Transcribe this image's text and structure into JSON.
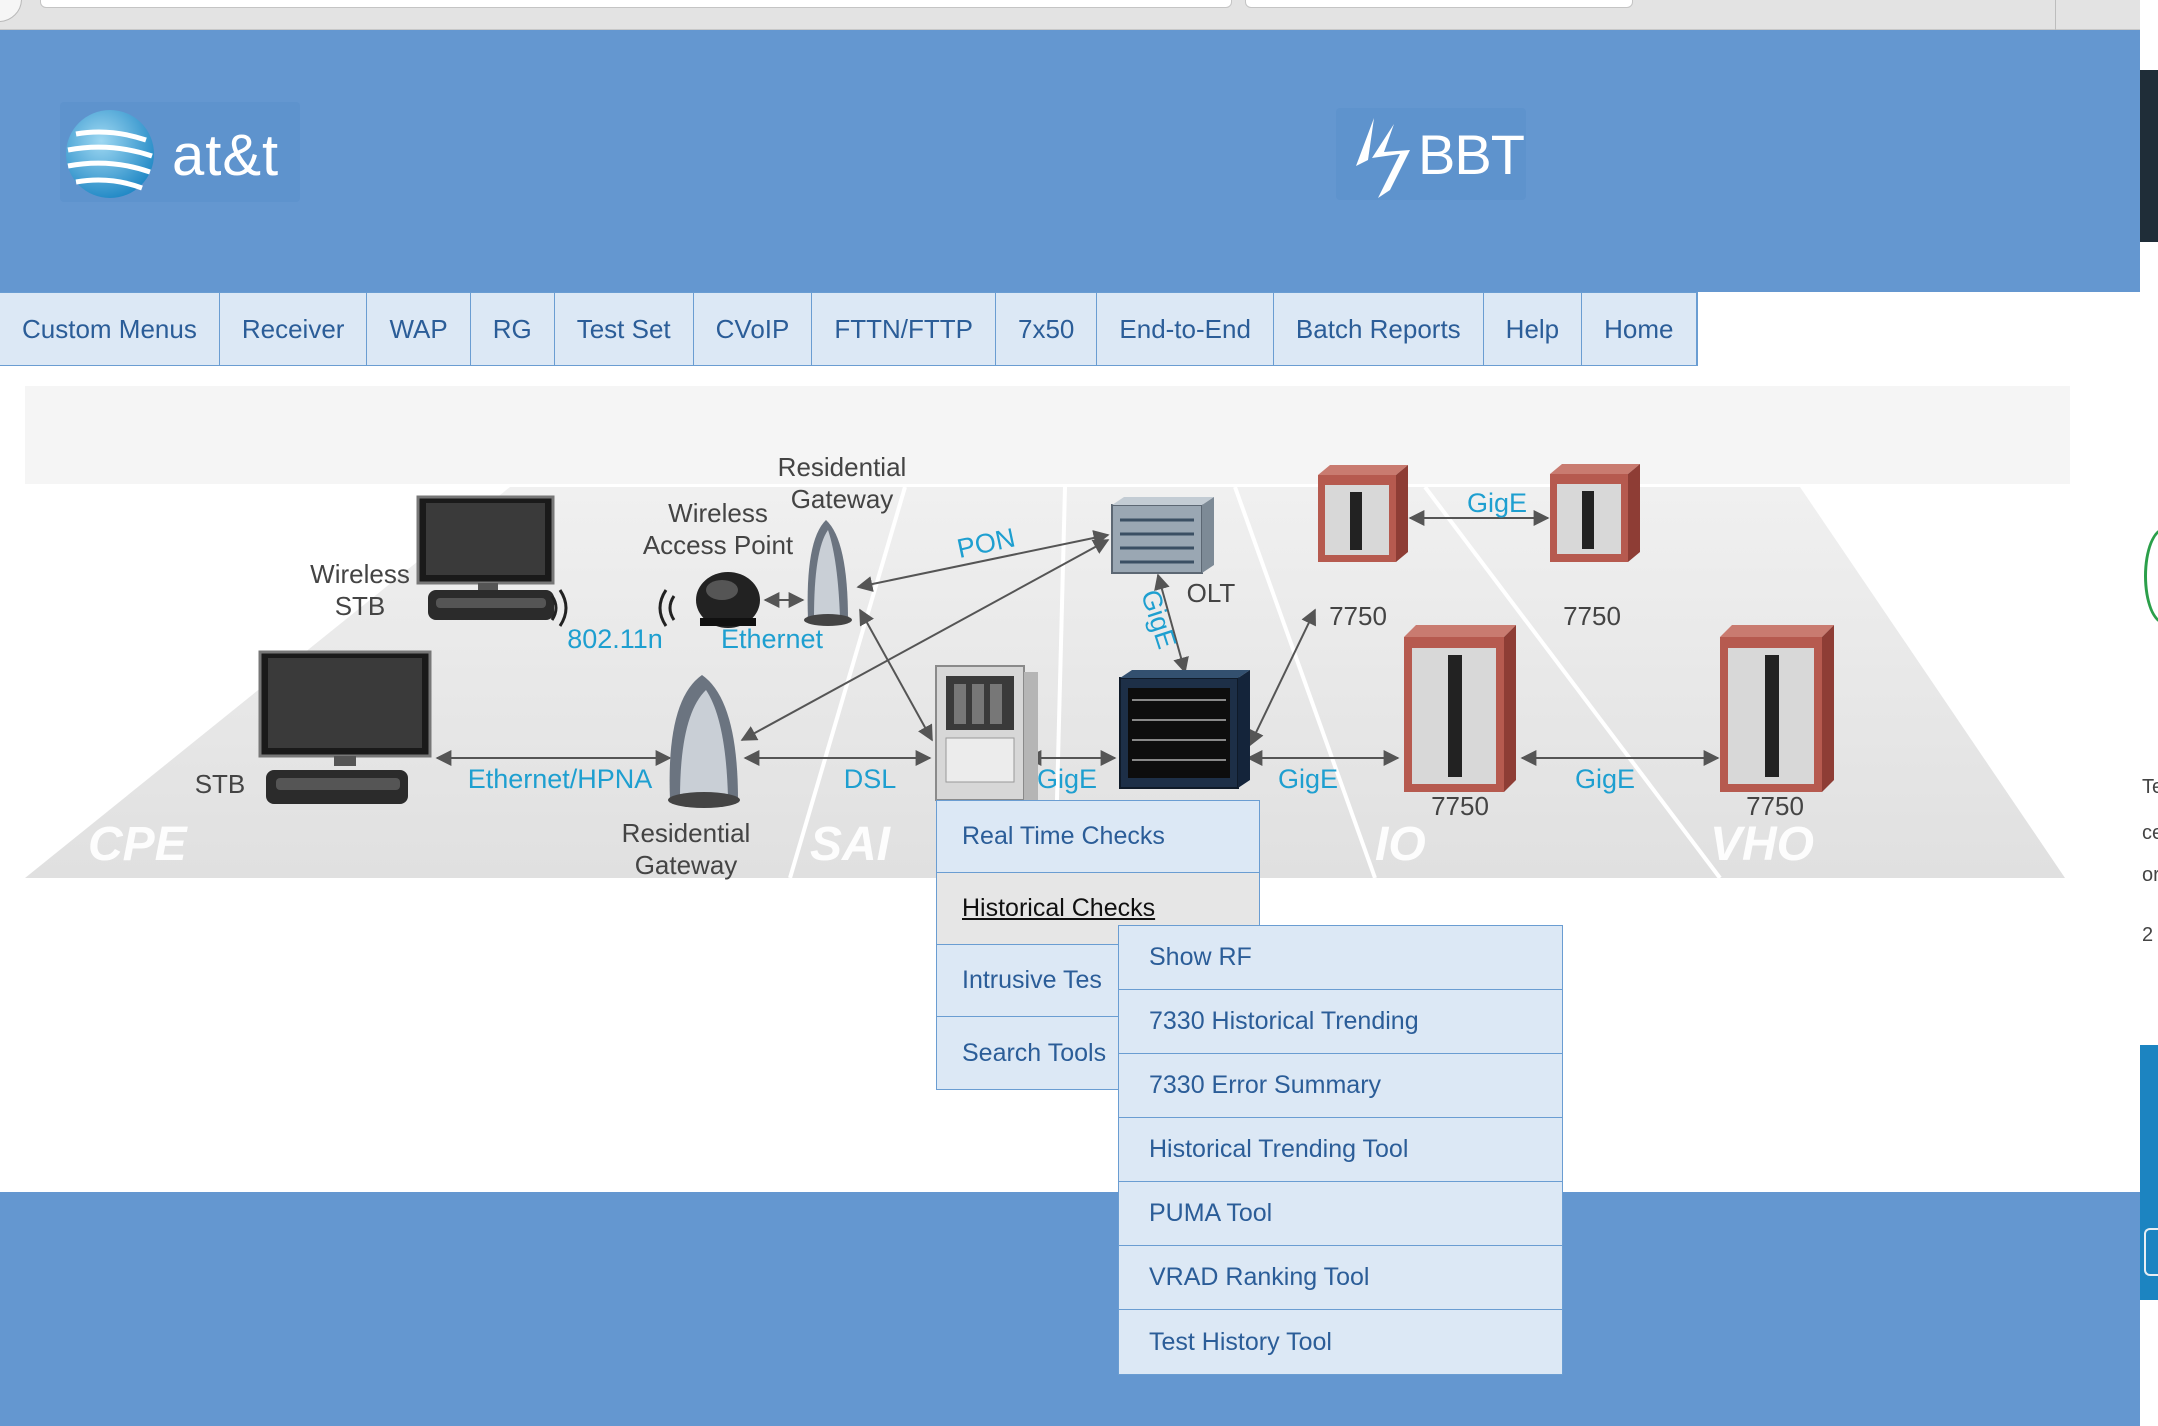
{
  "header": {
    "logo_left_text": "at&t",
    "logo_right_text": "BBT"
  },
  "nav": {
    "items": [
      {
        "label": "Custom Menus"
      },
      {
        "label": "Receiver"
      },
      {
        "label": "WAP"
      },
      {
        "label": "RG"
      },
      {
        "label": "Test Set"
      },
      {
        "label": "CVoIP"
      },
      {
        "label": "FTTN/FTTP"
      },
      {
        "label": "7x50"
      },
      {
        "label": "End-to-End"
      },
      {
        "label": "Batch Reports"
      },
      {
        "label": "Help"
      },
      {
        "label": "Home"
      }
    ]
  },
  "diagram": {
    "device_labels": {
      "wireless_stb": "Wireless STB",
      "wap": "Wireless Access Point",
      "rg_top": "Residential Gateway",
      "rg_bottom": "Residential Gateway",
      "stb": "STB",
      "olt": "OLT",
      "r7750_a": "7750",
      "r7750_b": "7750",
      "r7750_c": "7750",
      "r7750_d": "7750"
    },
    "link_labels": {
      "wifi": "802.11n",
      "ethernet": "Ethernet",
      "pon": "PON",
      "gige_top": "GigE",
      "gige_olt": "GigE",
      "ethernet_hpna": "Ethernet/HPNA",
      "dsl": "DSL",
      "gige_1": "GigE",
      "gige_2": "GigE",
      "gige_3": "GigE"
    },
    "zone_labels": {
      "cpe": "CPE",
      "sai": "SAI",
      "io": "IO",
      "vho": "VHO"
    },
    "colors": {
      "link_text": "#1e9fd0",
      "floor": "#e4e4e4",
      "router": "#b65a4f"
    }
  },
  "context_menu": {
    "items": [
      {
        "label": "Real Time Checks"
      },
      {
        "label": "Historical Checks"
      },
      {
        "label": "Intrusive Tes"
      },
      {
        "label": "Search Tools"
      }
    ],
    "active_item": "Historical Checks"
  },
  "submenu": {
    "items": [
      {
        "label": "Show RF"
      },
      {
        "label": "7330 Historical Trending"
      },
      {
        "label": "7330 Error Summary"
      },
      {
        "label": "Historical Trending Tool"
      },
      {
        "label": "PUMA Tool"
      },
      {
        "label": "VRAD Ranking Tool"
      },
      {
        "label": "Test History Tool"
      }
    ]
  },
  "right_edge": {
    "texts": [
      "Te",
      "ce",
      "or",
      "2"
    ]
  },
  "theme": {
    "header_bg": "#6497d0",
    "menu_bg": "#dce8f5",
    "menu_text": "#2b5d98"
  }
}
